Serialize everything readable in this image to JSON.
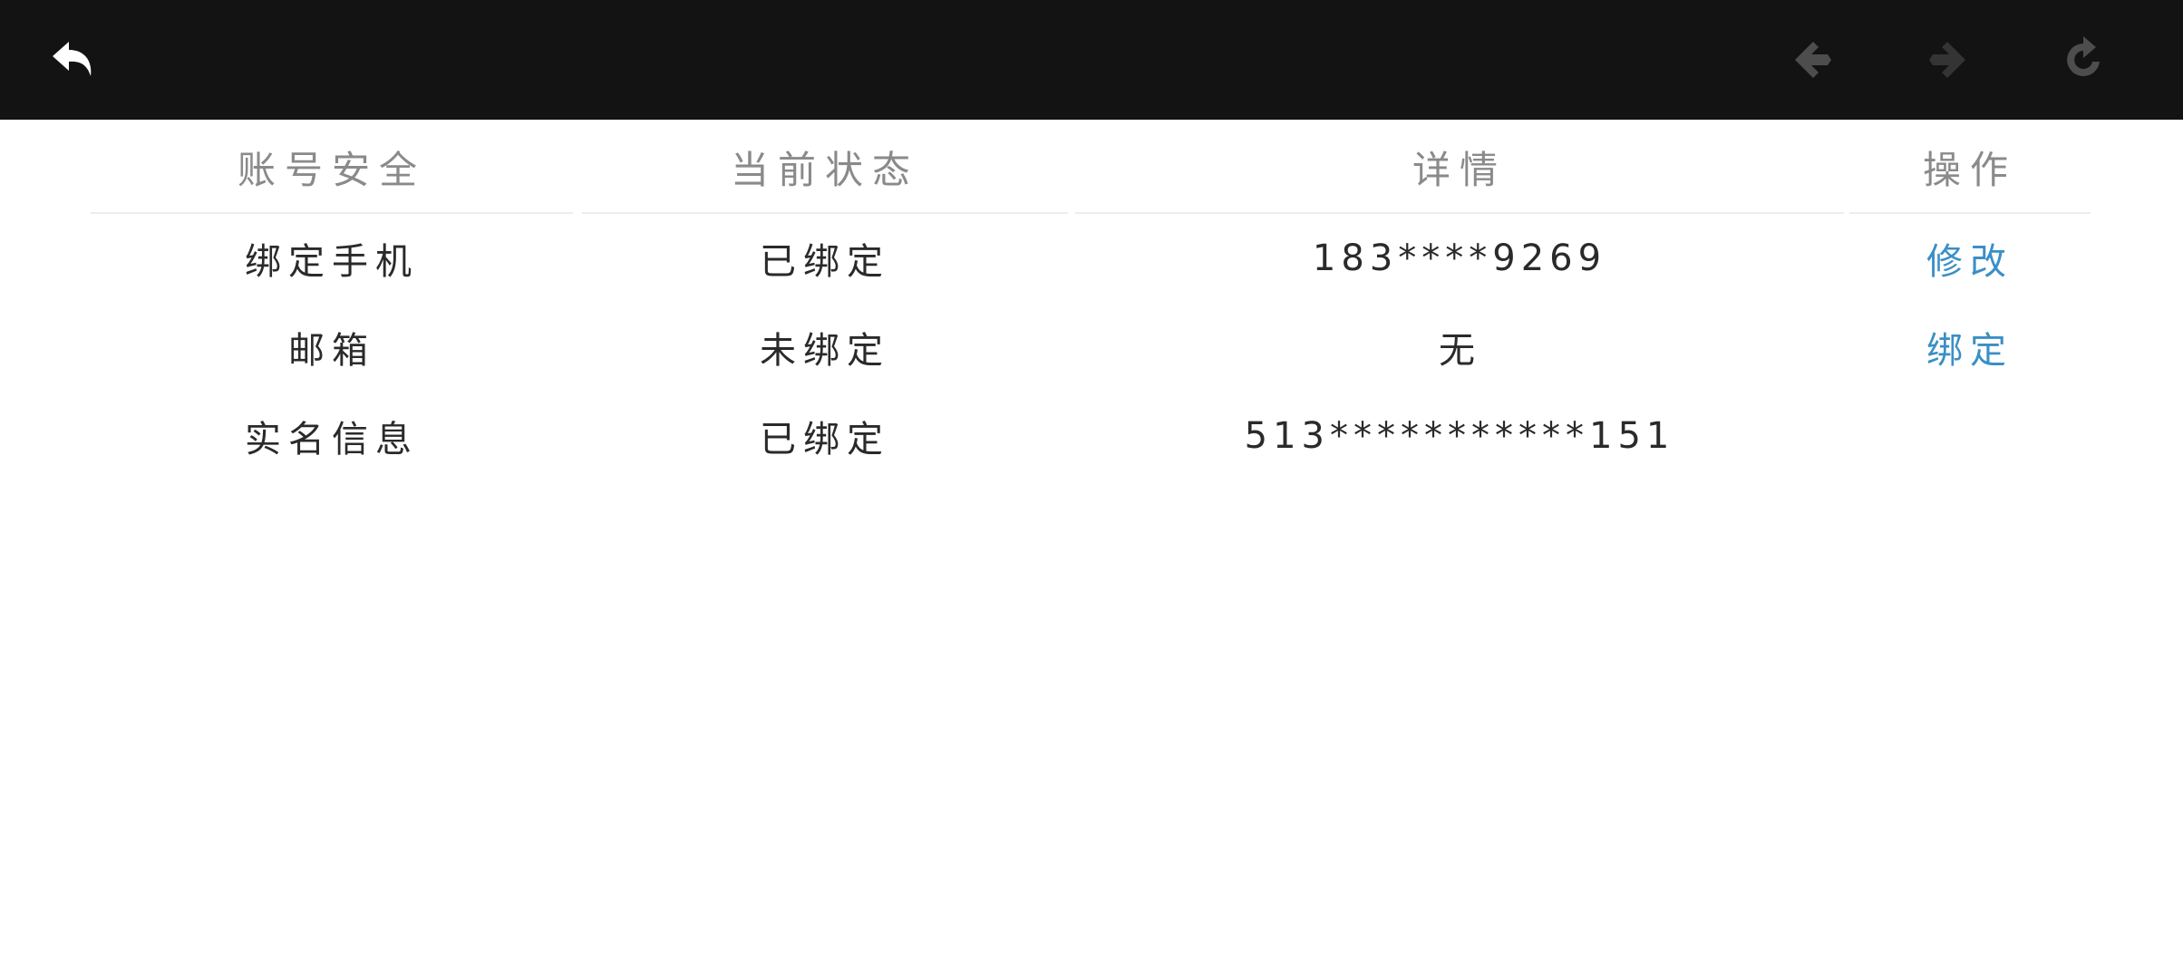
{
  "toolbar": {
    "back_icon": "back-arrow-icon",
    "prev_icon": "prev-diamond-arrow-icon",
    "next_icon": "next-diamond-arrow-icon",
    "refresh_icon": "refresh-icon",
    "colors": {
      "background": "#131313",
      "icon_active": "#ffffff",
      "icon_disabled": "#4a4a4a"
    }
  },
  "table": {
    "headers": [
      "账号安全",
      "当前状态",
      "详情",
      "操作"
    ],
    "rows": [
      {
        "item": "绑定手机",
        "status": "已绑定",
        "detail": "183****9269",
        "action": "修改"
      },
      {
        "item": "邮箱",
        "status": "未绑定",
        "detail": "无",
        "action": "绑定"
      },
      {
        "item": "实名信息",
        "status": "已绑定",
        "detail": "513***********151",
        "action": ""
      }
    ],
    "colors": {
      "header_text": "#8a8a8a",
      "body_text": "#2a2a2a",
      "action_text": "#3a8fc6",
      "divider": "#ececec"
    }
  }
}
